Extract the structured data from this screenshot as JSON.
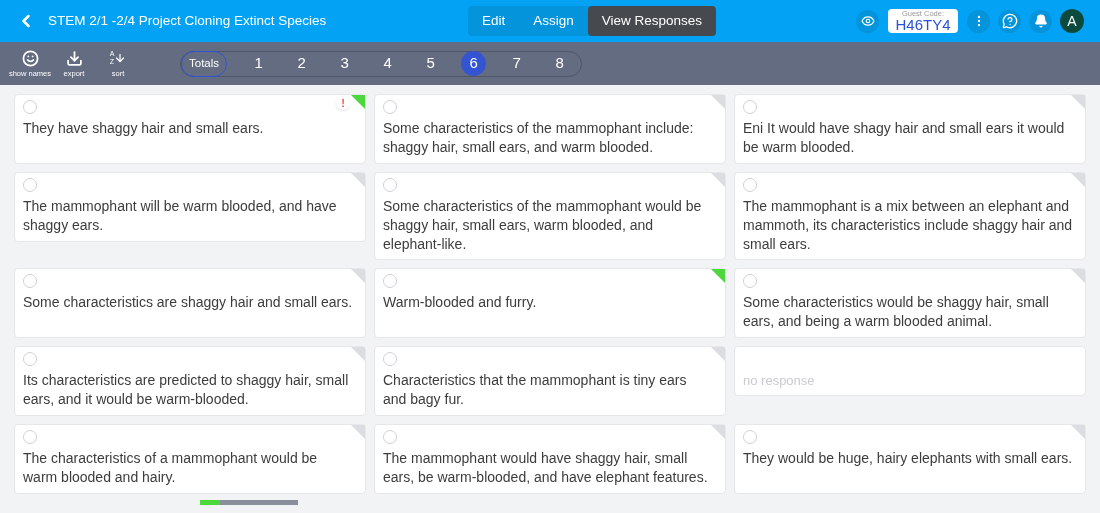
{
  "header": {
    "title": "STEM 2/1 -2/4 Project Cloning Extinct Species",
    "modes": [
      {
        "label": "Edit",
        "selected": false
      },
      {
        "label": "Assign",
        "selected": false
      },
      {
        "label": "View Responses",
        "selected": true
      }
    ],
    "guest_code_label": "Guest Code:",
    "guest_code": "H46TY4",
    "avatar": "A"
  },
  "toolbar": {
    "tools": [
      {
        "kind": "names",
        "label": "show names"
      },
      {
        "kind": "export",
        "label": "export"
      },
      {
        "kind": "sort",
        "label": "sort",
        "glyph_top": "A",
        "glyph_bottom": "Z"
      }
    ],
    "questions": [
      {
        "label": "Totals",
        "selected": false
      },
      {
        "label": "1",
        "selected": false
      },
      {
        "label": "2",
        "selected": false
      },
      {
        "label": "3",
        "selected": false
      },
      {
        "label": "4",
        "selected": false
      },
      {
        "label": "5",
        "selected": false
      },
      {
        "label": "6",
        "selected": true
      },
      {
        "label": "7",
        "selected": false
      },
      {
        "label": "8",
        "selected": false
      }
    ]
  },
  "responses": [
    {
      "kind": "answer",
      "text": "They have shaggy hair and small ears.",
      "selected": false,
      "marked": true,
      "alert": "!"
    },
    {
      "kind": "answer",
      "text": "Some characteristics of the mammophant include: shaggy hair, small ears, and warm blooded.",
      "selected": false,
      "marked": false
    },
    {
      "kind": "answer",
      "text": "Eni It would have shagy hair and small ears it would be warm blooded.",
      "selected": false,
      "marked": false
    },
    {
      "kind": "answer",
      "text": "The mammophant will be warm blooded, and have shaggy ears.",
      "selected": false,
      "marked": false
    },
    {
      "kind": "answer",
      "text": "Some characteristics of the mammophant would be shaggy hair, small ears, warm blooded, and elephant-like.",
      "selected": false,
      "marked": false
    },
    {
      "kind": "answer",
      "text": "The mammophant is a mix between an elephant and mammoth, its characteristics include shaggy hair and small ears.",
      "selected": false,
      "marked": false
    },
    {
      "kind": "answer",
      "text": "Some characteristics are shaggy hair and small ears.",
      "selected": false,
      "marked": false
    },
    {
      "kind": "answer",
      "text": "Warm-blooded and furry.",
      "selected": false,
      "marked": true
    },
    {
      "kind": "answer",
      "text": "Some characteristics would be shaggy hair, small ears, and being a warm blooded animal.",
      "selected": false,
      "marked": false
    },
    {
      "kind": "answer",
      "text": "Its characteristics are predicted to shaggy hair, small ears, and it would be warm-blooded.",
      "selected": false,
      "marked": false
    },
    {
      "kind": "answer",
      "text": "Characteristics that the mammophant is tiny ears and bagy fur.",
      "selected": false,
      "marked": false
    },
    {
      "kind": "empty",
      "text": "no response"
    },
    {
      "kind": "answer",
      "text": "The characteristics of a mammophant would be warm blooded and hairy.",
      "selected": false,
      "marked": false
    },
    {
      "kind": "answer",
      "text": "The mammophant would have shaggy hair, small ears, be warm-blooded, and have elephant features.",
      "selected": false,
      "marked": false
    },
    {
      "kind": "answer",
      "text": "They would be huge, hairy elephants with small ears.",
      "selected": false,
      "marked": false
    }
  ],
  "footer": {
    "progress": {
      "level": 0.2
    }
  }
}
